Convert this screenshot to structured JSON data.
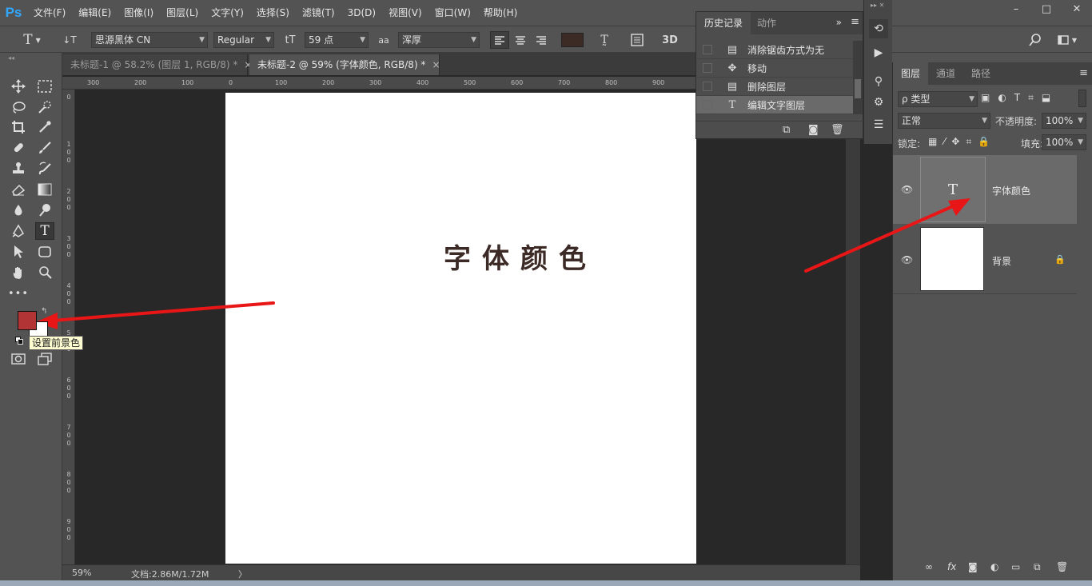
{
  "app": {
    "logo": "Ps"
  },
  "menu": [
    "文件(F)",
    "编辑(E)",
    "图像(I)",
    "图层(L)",
    "文字(Y)",
    "选择(S)",
    "滤镜(T)",
    "3D(D)",
    "视图(V)",
    "窗口(W)",
    "帮助(H)"
  ],
  "window_controls": {
    "minimize": "–",
    "maximize": "□",
    "close": "✕"
  },
  "options": {
    "tool_icon": "T",
    "orient_icon": "↓T",
    "font_family": "思源黑体 CN",
    "font_style": "Regular",
    "size_icon": "tT",
    "font_size": "59 点",
    "aa_icon": "aa",
    "antialias": "浑厚",
    "warp_icon": "T̰",
    "threeD": "3D",
    "color_hex": "#3c2a24"
  },
  "tabs": [
    {
      "label": "未标题-1 @ 58.2% (图层 1, RGB/8) *",
      "close": "×"
    },
    {
      "label": "未标题-2 @ 59% (字体颜色, RGB/8) *",
      "close": "×"
    }
  ],
  "ruler_top": [
    "300",
    "200",
    "100",
    "0",
    "100",
    "200",
    "300",
    "400",
    "500",
    "600",
    "700",
    "800",
    "900"
  ],
  "ruler_left": [
    "0",
    "1\n0\n0",
    "2\n0\n0",
    "3\n0\n0",
    "4\n0\n0",
    "5\n0\n0",
    "6\n0\n0",
    "7\n0\n0",
    "8\n0\n0",
    "9\n0\n0"
  ],
  "canvas": {
    "text": "字体颜色",
    "text_color": "#3c2a26"
  },
  "tools": {
    "foreground_color": "#b23434",
    "background_color": "#ffffff",
    "tooltip": "设置前景色"
  },
  "status": {
    "zoom": "59%",
    "doc": "文档:2.86M/1.72M",
    "arrow": "〉"
  },
  "history": {
    "tabs": [
      "历史记录",
      "动作"
    ],
    "items": [
      {
        "label": "消除锯齿方式为无",
        "icon": "document-icon"
      },
      {
        "label": "移动",
        "icon": "move-icon"
      },
      {
        "label": "删除图层",
        "icon": "document-icon"
      },
      {
        "label": "编辑文字图层",
        "icon": "type-icon"
      }
    ]
  },
  "layers": {
    "tabs": [
      "图层",
      "通道",
      "路径"
    ],
    "filter_label": "ρ 类型",
    "blend_mode": "正常",
    "opacity_label": "不透明度:",
    "opacity_value": "100%",
    "lock_label": "锁定:",
    "fill_label": "填充:",
    "fill_value": "100%",
    "items": [
      {
        "name": "字体颜色",
        "type": "text"
      },
      {
        "name": "背景",
        "type": "background"
      }
    ]
  },
  "colors": {
    "arrow": "#e81616"
  }
}
